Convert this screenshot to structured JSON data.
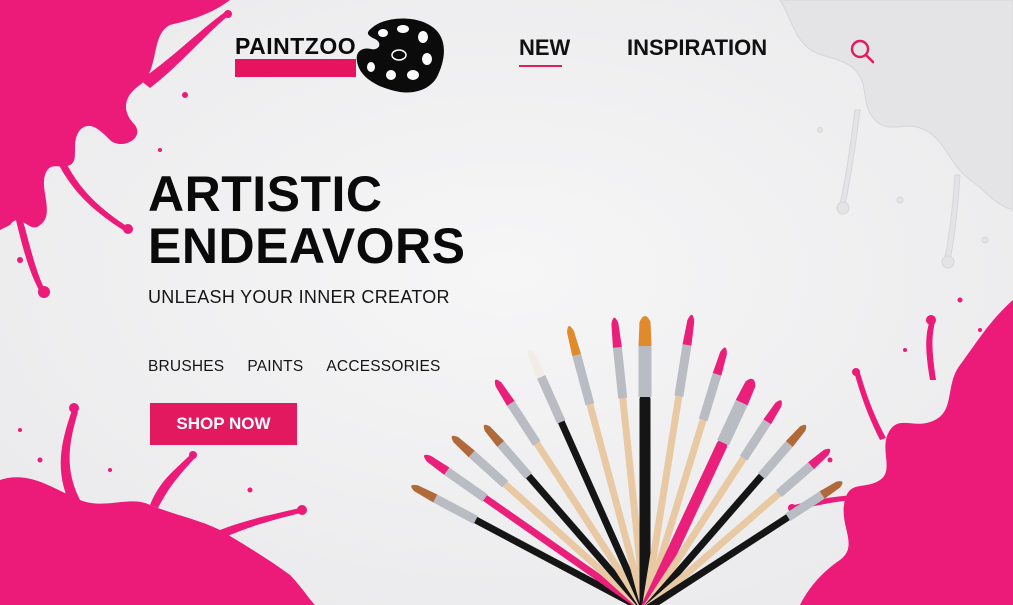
{
  "brand": {
    "name": "PAINTZOO",
    "accent": "#e3195f"
  },
  "nav": {
    "items": [
      {
        "label": "NEW",
        "active": true
      },
      {
        "label": "INSPIRATION",
        "active": false
      }
    ],
    "search_icon": "search-icon"
  },
  "hero": {
    "title_line1": "ARTISTIC",
    "title_line2": "ENDEAVORS",
    "subtitle": "UNLEASH YOUR INNER CREATOR",
    "categories": [
      "BRUSHES",
      "PAINTS",
      "ACCESSORIES"
    ],
    "cta_label": "SHOP NOW"
  },
  "colors": {
    "background": "#f1f1f2",
    "splash_pink": "#ec1a78",
    "splash_white": "#e7e7e9",
    "text": "#0a0a0a"
  }
}
